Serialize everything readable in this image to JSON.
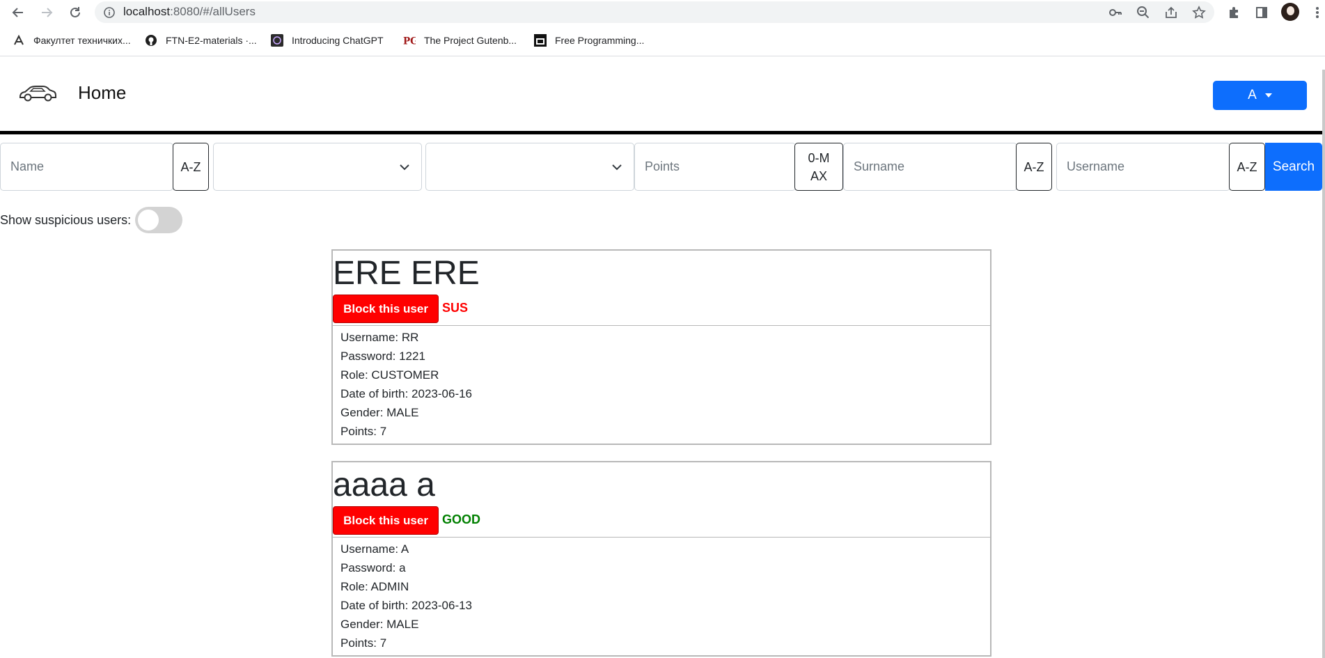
{
  "browser": {
    "url_host": "localhost",
    "url_rest": ":8080/#/allUsers",
    "bookmarks": [
      {
        "label": "Факултет техничких...",
        "icon": "university-icon"
      },
      {
        "label": "FTN-E2-materials ·...",
        "icon": "github-icon"
      },
      {
        "label": "Introducing ChatGPT",
        "icon": "chatgpt-icon"
      },
      {
        "label": "The Project Gutenb...",
        "icon": "gutenberg-icon"
      },
      {
        "label": "Free Programming...",
        "icon": "book-icon"
      }
    ]
  },
  "header": {
    "home_label": "Home",
    "user_menu_label": "A"
  },
  "filters": {
    "name_placeholder": "Name",
    "name_sort": "A-Z",
    "points_placeholder": "Points",
    "points_sort": "0-MAX",
    "surname_placeholder": "Surname",
    "surname_sort": "A-Z",
    "username_placeholder": "Username",
    "username_sort": "A-Z",
    "search_label": "Search"
  },
  "toggle": {
    "label": "Show suspicious users:",
    "on": false
  },
  "users": [
    {
      "full_name": "ERE ERE",
      "block_label": "Block this user",
      "status": "SUS",
      "username": "Username: RR",
      "password": "Password: 1221",
      "role": "Role: CUSTOMER",
      "dob": "Date of birth: 2023-06-16",
      "gender": "Gender: MALE",
      "points": "Points: 7"
    },
    {
      "full_name": "aaaa a",
      "block_label": "Block this user",
      "status": "GOOD",
      "username": "Username: A",
      "password": "Password: a",
      "role": "Role: ADMIN",
      "dob": "Date of birth: 2023-06-13",
      "gender": "Gender: MALE",
      "points": "Points: 7"
    }
  ],
  "colors": {
    "primary": "#0d6efd",
    "danger": "#ff0000",
    "good": "#008000"
  }
}
